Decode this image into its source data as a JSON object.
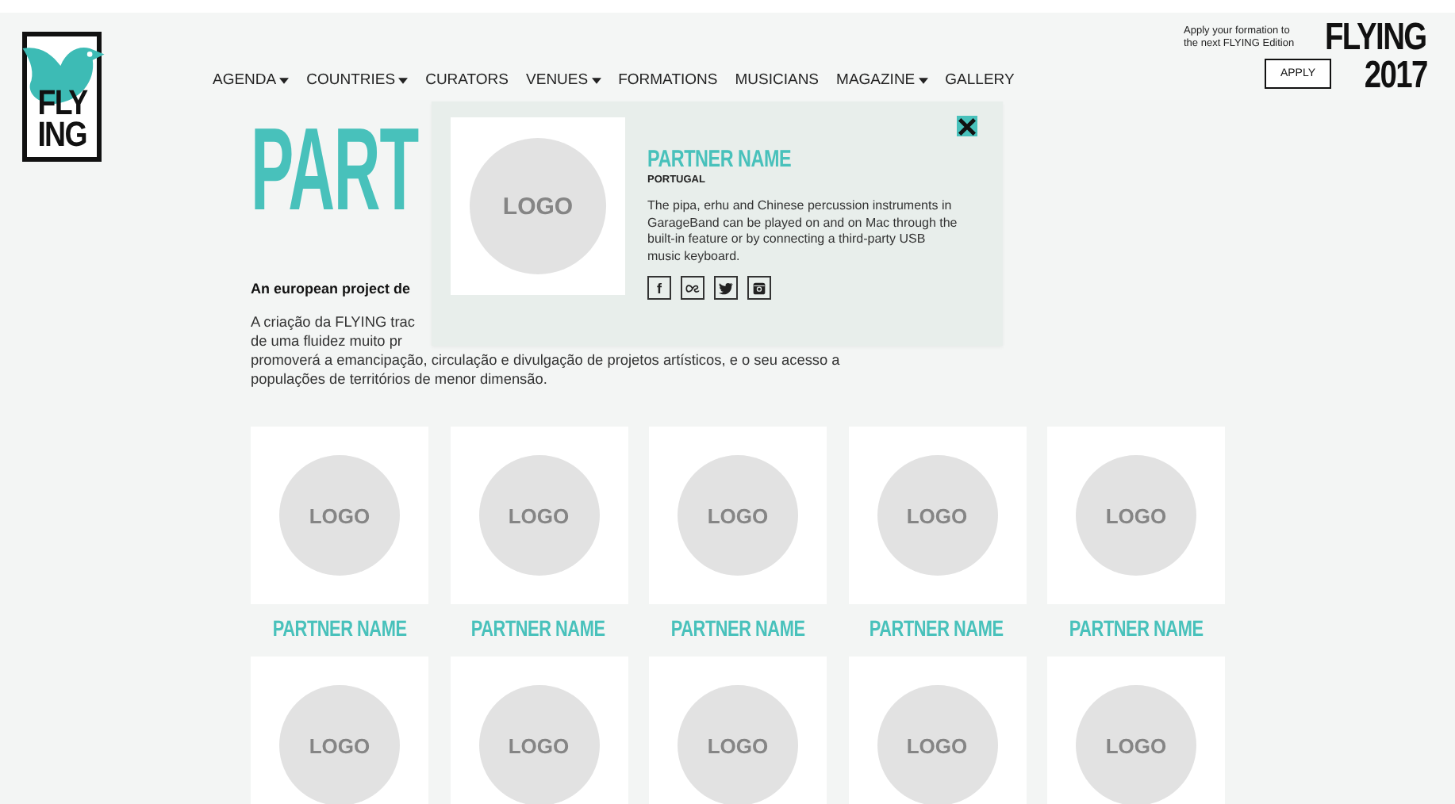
{
  "logo": {
    "line1": "FLY",
    "line2": "ING"
  },
  "nav": [
    {
      "label": "AGENDA",
      "dropdown": true
    },
    {
      "label": "COUNTRIES",
      "dropdown": true
    },
    {
      "label": "CURATORS",
      "dropdown": false
    },
    {
      "label": "VENUES",
      "dropdown": true
    },
    {
      "label": "FORMATIONS",
      "dropdown": false
    },
    {
      "label": "MUSICIANS",
      "dropdown": false
    },
    {
      "label": "MAGAZINE",
      "dropdown": true
    },
    {
      "label": "GALLERY",
      "dropdown": false
    }
  ],
  "apply": {
    "text": "Apply your formation to the next FLYING Edition",
    "button": "APPLY"
  },
  "edition": {
    "line1": "FLYING",
    "line2": "2017"
  },
  "page": {
    "title": "PART",
    "intro": "An european project de",
    "paragraph": [
      "A criação da FLYING trac",
      "de uma fluidez muito pr",
      "promoverá a emancipação, circulação e divulgação de projetos artísticos, e o seu acesso a",
      "populações de territórios de menor dimensão."
    ]
  },
  "popup": {
    "logo": "LOGO",
    "name": "PARTNER NAME",
    "country": "PORTUGAL",
    "description": "The pipa, erhu and Chinese percussion instruments in GarageBand can be played on and on Mac through the built-in feature or by connecting a third-party USB music keyboard.",
    "social": [
      {
        "kind": "facebook",
        "label": "f"
      },
      {
        "kind": "lastfm"
      },
      {
        "kind": "twitter"
      },
      {
        "kind": "instagram"
      }
    ]
  },
  "partners": [
    {
      "logo": "LOGO",
      "name": "PARTNER NAME"
    },
    {
      "logo": "LOGO",
      "name": "PARTNER NAME"
    },
    {
      "logo": "LOGO",
      "name": "PARTNER NAME"
    },
    {
      "logo": "LOGO",
      "name": "PARTNER NAME"
    },
    {
      "logo": "LOGO",
      "name": "PARTNER NAME"
    },
    {
      "logo": "LOGO"
    },
    {
      "logo": "LOGO"
    },
    {
      "logo": "LOGO"
    },
    {
      "logo": "LOGO"
    },
    {
      "logo": "LOGO"
    }
  ]
}
